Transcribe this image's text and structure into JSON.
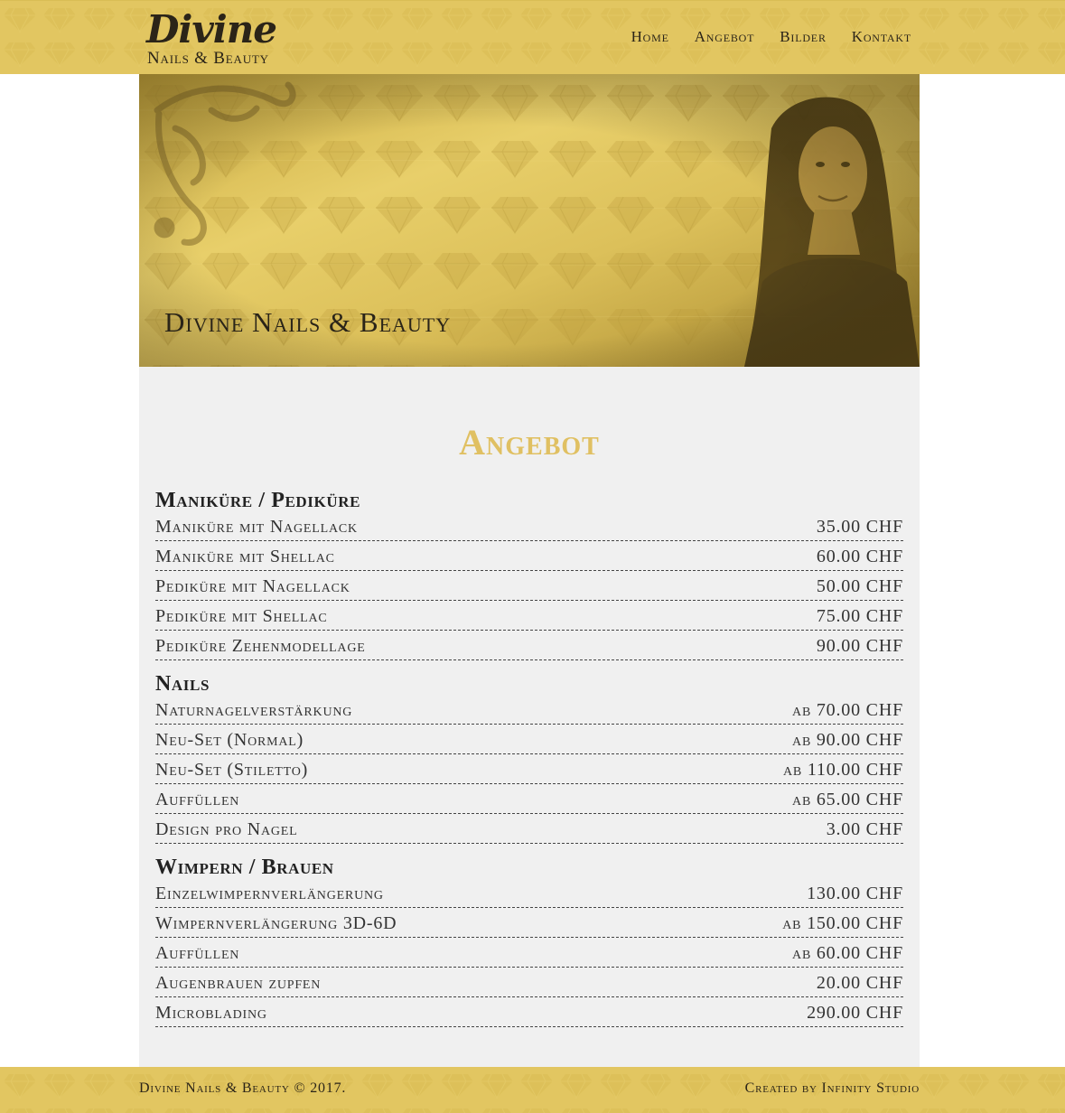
{
  "brand": {
    "script": "Divine",
    "subtitle": "Nails & Beauty"
  },
  "nav": {
    "items": [
      {
        "label": "Home"
      },
      {
        "label": "Angebot"
      },
      {
        "label": "Bilder"
      },
      {
        "label": "Kontakt"
      }
    ]
  },
  "hero": {
    "title": "Divine Nails & Beauty"
  },
  "main": {
    "heading": "Angebot",
    "categories": [
      {
        "title": "Maniküre / Pediküre",
        "items": [
          {
            "name": "Maniküre mit Nagellack",
            "price": "35.00 CHF"
          },
          {
            "name": "Maniküre mit Shellac",
            "price": "60.00 CHF"
          },
          {
            "name": "Pediküre mit Nagellack",
            "price": "50.00 CHF"
          },
          {
            "name": "Pediküre mit Shellac",
            "price": "75.00 CHF"
          },
          {
            "name": "Pediküre Zehenmodellage",
            "price": "90.00 CHF"
          }
        ]
      },
      {
        "title": "Nails",
        "items": [
          {
            "name": "Naturnagelverstärkung",
            "price": "ab 70.00 CHF"
          },
          {
            "name": "Neu-Set (Normal)",
            "price": "ab 90.00 CHF"
          },
          {
            "name": "Neu-Set (Stiletto)",
            "price": "ab 110.00 CHF"
          },
          {
            "name": "Auffüllen",
            "price": "ab 65.00 CHF"
          },
          {
            "name": "Design pro Nagel",
            "price": "3.00 CHF"
          }
        ]
      },
      {
        "title": "Wimpern / Brauen",
        "items": [
          {
            "name": "Einzelwimpernverlängerung",
            "price": "130.00 CHF"
          },
          {
            "name": "Wimpernverlängerung 3D-6D",
            "price": "ab 150.00 CHF"
          },
          {
            "name": "Auffüllen",
            "price": "ab 60.00 CHF"
          },
          {
            "name": "Augenbrauen zupfen",
            "price": "20.00 CHF"
          },
          {
            "name": "Microblading",
            "price": "290.00 CHF"
          }
        ]
      }
    ]
  },
  "footer": {
    "left": "Divine Nails & Beauty © 2017.",
    "right": "Created by Infinity Studio"
  },
  "colors": {
    "gold": "#e2c661",
    "heading_gold": "#e0c062",
    "panel_bg": "#f0f0f0"
  },
  "icons": [
    "diamond-pattern",
    "flourish-ornament"
  ]
}
